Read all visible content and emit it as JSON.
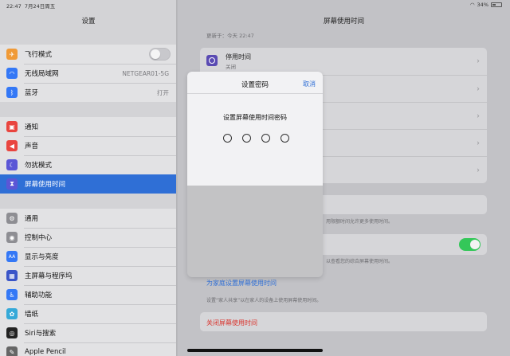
{
  "status": {
    "time": "22:47",
    "date": "7月24日周五",
    "battery": "34%"
  },
  "sidebar": {
    "title": "设置",
    "groups": [
      [
        {
          "label": "飞行模式",
          "icon": "airplane-icon",
          "color": "#f09a37",
          "glyph": "✈"
        },
        {
          "label": "无线局域网",
          "icon": "wifi-icon",
          "color": "#3478f6",
          "glyph": "◠",
          "value": "NETGEAR01-5G"
        },
        {
          "label": "蓝牙",
          "icon": "bluetooth-icon",
          "color": "#3478f6",
          "glyph": "ᛒ",
          "value": "打开"
        }
      ],
      [
        {
          "label": "通知",
          "icon": "notifications-icon",
          "color": "#e9453f",
          "glyph": "▣"
        },
        {
          "label": "声音",
          "icon": "sound-icon",
          "color": "#e9453f",
          "glyph": "◀"
        },
        {
          "label": "勿扰模式",
          "icon": "moon-icon",
          "color": "#5b56d6",
          "glyph": "☾"
        },
        {
          "label": "屏幕使用时间",
          "icon": "hourglass-icon",
          "color": "#5b56d6",
          "glyph": "⧗"
        }
      ],
      [
        {
          "label": "通用",
          "icon": "gear-icon",
          "color": "#8e8e93",
          "glyph": "⚙"
        },
        {
          "label": "控制中心",
          "icon": "control-center-icon",
          "color": "#8e8e93",
          "glyph": "◉"
        },
        {
          "label": "显示与亮度",
          "icon": "display-icon",
          "color": "#3478f6",
          "glyph": "AA"
        },
        {
          "label": "主屏幕与程序坞",
          "icon": "home-screen-icon",
          "color": "#3a55c8",
          "glyph": "▦"
        },
        {
          "label": "辅助功能",
          "icon": "accessibility-icon",
          "color": "#3478f6",
          "glyph": "♿"
        },
        {
          "label": "墙纸",
          "icon": "wallpaper-icon",
          "color": "#35a9d8",
          "glyph": "✿"
        },
        {
          "label": "Siri与搜索",
          "icon": "siri-icon",
          "color": "#222222",
          "glyph": "◎"
        },
        {
          "label": "Apple Pencil",
          "icon": "pencil-icon",
          "color": "#666666",
          "glyph": "✎"
        }
      ]
    ]
  },
  "main": {
    "title": "屏幕使用时间",
    "updated": "更新于：今天 22:47",
    "downtime_title": "停用时间",
    "downtime_sub": "关闭",
    "note_limits": "用限额时间允许更多使用时间。",
    "note_share": "以查看您的综合屏幕使用时间。",
    "family_link": "为家庭设置屏幕使用时间",
    "family_note": "设置“家人共享”以在家人的设备上使用屏幕使用时间。",
    "turn_off": "关闭屏幕使用时间"
  },
  "modal": {
    "title": "设置密码",
    "cancel": "取消",
    "prompt": "设置屏幕使用时间密码"
  }
}
